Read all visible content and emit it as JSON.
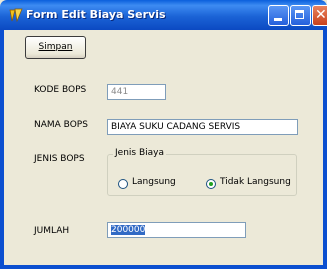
{
  "window": {
    "title": "Form Edit Biaya Servis",
    "controls": {
      "minimize": "minimize-icon",
      "maximize": "maximize-icon",
      "close": "close-icon"
    },
    "colors": {
      "titlebar": "#0b57d0",
      "face": "#ece9d8",
      "selection": "#316ac5",
      "radio_dot": "#21a121"
    }
  },
  "toolbar": {
    "save_label": "Simpan"
  },
  "form": {
    "kode_label": "KODE BOPS",
    "kode_value": "441",
    "nama_label": "NAMA BOPS",
    "nama_value": "BIAYA SUKU CADANG SERVIS",
    "jenis_label": "JENIS BOPS",
    "jenis_group_title": "Jenis Biaya",
    "jenis_options": [
      {
        "label": "Langsung",
        "checked": false
      },
      {
        "label": "Tidak Langsung",
        "checked": true
      }
    ],
    "jumlah_label": "JUMLAH",
    "jumlah_value": "200000"
  }
}
